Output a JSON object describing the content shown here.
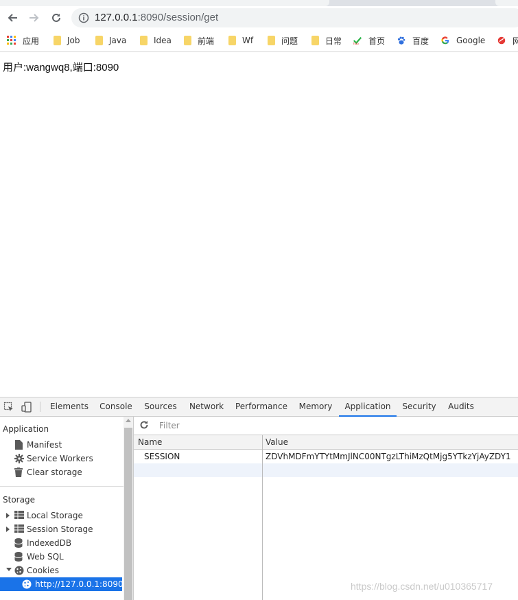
{
  "browser": {
    "url_host": "127.0.0.1",
    "url_rest": ":8090/session/get"
  },
  "bookmarks": [
    {
      "label": "应用",
      "icon": "apps-grid-icon"
    },
    {
      "label": "Job",
      "icon": "folder-icon"
    },
    {
      "label": "Java",
      "icon": "folder-icon"
    },
    {
      "label": "Idea",
      "icon": "folder-icon"
    },
    {
      "label": "前端",
      "icon": "folder-icon"
    },
    {
      "label": "Wf",
      "icon": "folder-icon"
    },
    {
      "label": "问题",
      "icon": "folder-icon"
    },
    {
      "label": "日常",
      "icon": "folder-icon"
    },
    {
      "label": "首页",
      "icon": "hao123-icon"
    },
    {
      "label": "百度",
      "icon": "baidu-paw-icon"
    },
    {
      "label": "Google",
      "icon": "google-g-icon"
    },
    {
      "label": "网",
      "icon": "netease-icon"
    }
  ],
  "page": {
    "text": "用户:wangwq8,端口:8090"
  },
  "devtools": {
    "tabs": [
      {
        "label": "Elements"
      },
      {
        "label": "Console"
      },
      {
        "label": "Sources"
      },
      {
        "label": "Network"
      },
      {
        "label": "Performance"
      },
      {
        "label": "Memory"
      },
      {
        "label": "Application",
        "active": true
      },
      {
        "label": "Security"
      },
      {
        "label": "Audits"
      }
    ],
    "sidebar": {
      "application_heading": "Application",
      "application_items": [
        "Manifest",
        "Service Workers",
        "Clear storage"
      ],
      "storage_heading": "Storage",
      "storage_items": [
        "Local Storage",
        "Session Storage",
        "IndexedDB",
        "Web SQL",
        "Cookies"
      ],
      "cookie_origin": "http://127.0.0.1:8090"
    },
    "filter_placeholder": "Filter",
    "table": {
      "columns": [
        "Name",
        "Value"
      ],
      "rows": [
        {
          "name": "SESSION",
          "value": "ZDVhMDFmYTYtMmJlNC00NTgzLThiMzQtMjg5YTkzYjAyZDY1"
        }
      ]
    },
    "accent_color": "#1a73e8"
  },
  "watermark": "https://blog.csdn.net/u010365717"
}
